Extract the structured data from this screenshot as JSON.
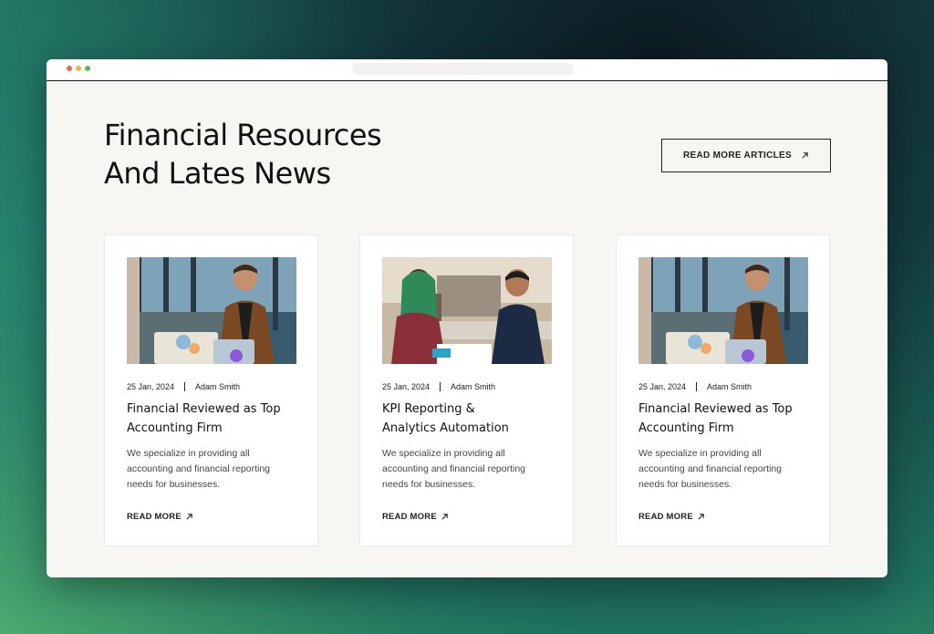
{
  "section": {
    "title_line1": "Financial Resources",
    "title_line2": "And Lates News",
    "cta_label": "READ MORE ARTICLES"
  },
  "window": {
    "dot_colors": [
      "#e46b5b",
      "#e9b74b",
      "#5bb562"
    ]
  },
  "cards": [
    {
      "date": "25 Jan, 2024",
      "author": "Adam Smith",
      "title_line1": "Financial Reviewed as Top",
      "title_line2": "Accounting Firm",
      "desc_line1": "We specialize in providing all",
      "desc_line2": "accounting and financial reporting",
      "desc_line3": "needs for businesses.",
      "link_label": "READ MORE"
    },
    {
      "date": "25 Jan, 2024",
      "author": "Adam Smith",
      "title_line1": "KPI Reporting &",
      "title_line2": "Analytics Automation",
      "desc_line1": "We specialize in providing all",
      "desc_line2": "accounting and financial reporting",
      "desc_line3": "needs for businesses.",
      "link_label": "READ MORE"
    },
    {
      "date": "25 Jan, 2024",
      "author": "Adam Smith",
      "title_line1": "Financial Reviewed as Top",
      "title_line2": "Accounting Firm",
      "desc_line1": "We specialize in providing all",
      "desc_line2": "accounting and financial reporting",
      "desc_line3": "needs for businesses.",
      "link_label": "READ MORE"
    }
  ]
}
